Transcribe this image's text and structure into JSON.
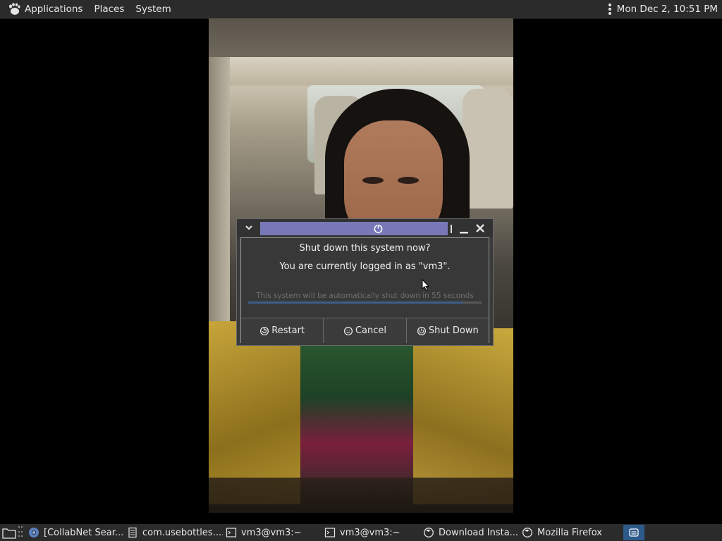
{
  "top_panel": {
    "menus": [
      "Applications",
      "Places",
      "System"
    ],
    "clock": "Mon Dec  2, 10:51 PM"
  },
  "dialog": {
    "question": "Shut down this system now?",
    "logged_in": "You are currently logged in as \"vm3\".",
    "countdown": "This system will be automatically shut down in 55 seconds",
    "progress_fraction": 0.92,
    "buttons": {
      "restart": "Restart",
      "cancel": "Cancel",
      "shutdown": "Shut Down"
    }
  },
  "taskbar": {
    "tasks": [
      {
        "label": "[CollabNet Sear...",
        "icon": "chromium-icon"
      },
      {
        "label": "com.usebottles....",
        "icon": "text-editor-icon"
      },
      {
        "label": "vm3@vm3:~",
        "icon": "terminal-icon"
      },
      {
        "label": "vm3@vm3:~",
        "icon": "terminal-icon"
      },
      {
        "label": "Download Insta...",
        "icon": "firefox-icon"
      },
      {
        "label": "Mozilla Firefox",
        "icon": "firefox-icon"
      }
    ]
  },
  "colors": {
    "panel_bg": "#2b2b2b",
    "dialog_bg": "#3a3a3a",
    "title_accent": "#7878b8",
    "progress": "#3c5f8a",
    "tray_active": "#2d5a8a"
  }
}
